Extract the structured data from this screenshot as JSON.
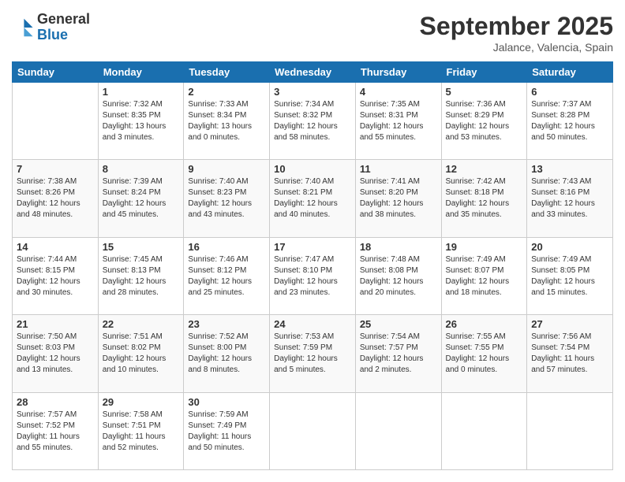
{
  "logo": {
    "line1": "General",
    "line2": "Blue"
  },
  "title": "September 2025",
  "location": "Jalance, Valencia, Spain",
  "days_header": [
    "Sunday",
    "Monday",
    "Tuesday",
    "Wednesday",
    "Thursday",
    "Friday",
    "Saturday"
  ],
  "weeks": [
    [
      {
        "day": "",
        "info": ""
      },
      {
        "day": "1",
        "info": "Sunrise: 7:32 AM\nSunset: 8:35 PM\nDaylight: 13 hours\nand 3 minutes."
      },
      {
        "day": "2",
        "info": "Sunrise: 7:33 AM\nSunset: 8:34 PM\nDaylight: 13 hours\nand 0 minutes."
      },
      {
        "day": "3",
        "info": "Sunrise: 7:34 AM\nSunset: 8:32 PM\nDaylight: 12 hours\nand 58 minutes."
      },
      {
        "day": "4",
        "info": "Sunrise: 7:35 AM\nSunset: 8:31 PM\nDaylight: 12 hours\nand 55 minutes."
      },
      {
        "day": "5",
        "info": "Sunrise: 7:36 AM\nSunset: 8:29 PM\nDaylight: 12 hours\nand 53 minutes."
      },
      {
        "day": "6",
        "info": "Sunrise: 7:37 AM\nSunset: 8:28 PM\nDaylight: 12 hours\nand 50 minutes."
      }
    ],
    [
      {
        "day": "7",
        "info": "Sunrise: 7:38 AM\nSunset: 8:26 PM\nDaylight: 12 hours\nand 48 minutes."
      },
      {
        "day": "8",
        "info": "Sunrise: 7:39 AM\nSunset: 8:24 PM\nDaylight: 12 hours\nand 45 minutes."
      },
      {
        "day": "9",
        "info": "Sunrise: 7:40 AM\nSunset: 8:23 PM\nDaylight: 12 hours\nand 43 minutes."
      },
      {
        "day": "10",
        "info": "Sunrise: 7:40 AM\nSunset: 8:21 PM\nDaylight: 12 hours\nand 40 minutes."
      },
      {
        "day": "11",
        "info": "Sunrise: 7:41 AM\nSunset: 8:20 PM\nDaylight: 12 hours\nand 38 minutes."
      },
      {
        "day": "12",
        "info": "Sunrise: 7:42 AM\nSunset: 8:18 PM\nDaylight: 12 hours\nand 35 minutes."
      },
      {
        "day": "13",
        "info": "Sunrise: 7:43 AM\nSunset: 8:16 PM\nDaylight: 12 hours\nand 33 minutes."
      }
    ],
    [
      {
        "day": "14",
        "info": "Sunrise: 7:44 AM\nSunset: 8:15 PM\nDaylight: 12 hours\nand 30 minutes."
      },
      {
        "day": "15",
        "info": "Sunrise: 7:45 AM\nSunset: 8:13 PM\nDaylight: 12 hours\nand 28 minutes."
      },
      {
        "day": "16",
        "info": "Sunrise: 7:46 AM\nSunset: 8:12 PM\nDaylight: 12 hours\nand 25 minutes."
      },
      {
        "day": "17",
        "info": "Sunrise: 7:47 AM\nSunset: 8:10 PM\nDaylight: 12 hours\nand 23 minutes."
      },
      {
        "day": "18",
        "info": "Sunrise: 7:48 AM\nSunset: 8:08 PM\nDaylight: 12 hours\nand 20 minutes."
      },
      {
        "day": "19",
        "info": "Sunrise: 7:49 AM\nSunset: 8:07 PM\nDaylight: 12 hours\nand 18 minutes."
      },
      {
        "day": "20",
        "info": "Sunrise: 7:49 AM\nSunset: 8:05 PM\nDaylight: 12 hours\nand 15 minutes."
      }
    ],
    [
      {
        "day": "21",
        "info": "Sunrise: 7:50 AM\nSunset: 8:03 PM\nDaylight: 12 hours\nand 13 minutes."
      },
      {
        "day": "22",
        "info": "Sunrise: 7:51 AM\nSunset: 8:02 PM\nDaylight: 12 hours\nand 10 minutes."
      },
      {
        "day": "23",
        "info": "Sunrise: 7:52 AM\nSunset: 8:00 PM\nDaylight: 12 hours\nand 8 minutes."
      },
      {
        "day": "24",
        "info": "Sunrise: 7:53 AM\nSunset: 7:59 PM\nDaylight: 12 hours\nand 5 minutes."
      },
      {
        "day": "25",
        "info": "Sunrise: 7:54 AM\nSunset: 7:57 PM\nDaylight: 12 hours\nand 2 minutes."
      },
      {
        "day": "26",
        "info": "Sunrise: 7:55 AM\nSunset: 7:55 PM\nDaylight: 12 hours\nand 0 minutes."
      },
      {
        "day": "27",
        "info": "Sunrise: 7:56 AM\nSunset: 7:54 PM\nDaylight: 11 hours\nand 57 minutes."
      }
    ],
    [
      {
        "day": "28",
        "info": "Sunrise: 7:57 AM\nSunset: 7:52 PM\nDaylight: 11 hours\nand 55 minutes."
      },
      {
        "day": "29",
        "info": "Sunrise: 7:58 AM\nSunset: 7:51 PM\nDaylight: 11 hours\nand 52 minutes."
      },
      {
        "day": "30",
        "info": "Sunrise: 7:59 AM\nSunset: 7:49 PM\nDaylight: 11 hours\nand 50 minutes."
      },
      {
        "day": "",
        "info": ""
      },
      {
        "day": "",
        "info": ""
      },
      {
        "day": "",
        "info": ""
      },
      {
        "day": "",
        "info": ""
      }
    ]
  ]
}
